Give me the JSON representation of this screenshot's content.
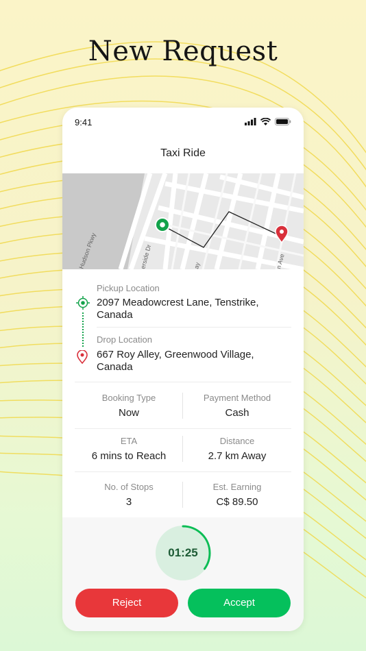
{
  "headline": "New Request",
  "status_bar": {
    "time": "9:41"
  },
  "screen": {
    "title": "Taxi Ride"
  },
  "map": {
    "street_labels": [
      "Hudson Pkwy",
      "erside Dr",
      "ay",
      "n Ave"
    ]
  },
  "pickup": {
    "label": "Pickup Location",
    "address": "2097 Meadowcrest Lane, Tenstrike, Canada"
  },
  "drop": {
    "label": "Drop Location",
    "address": "667 Roy Alley, Greenwood Village, Canada"
  },
  "details": {
    "booking_type": {
      "label": "Booking Type",
      "value": "Now"
    },
    "payment_method": {
      "label": "Payment Method",
      "value": "Cash"
    },
    "eta": {
      "label": "ETA",
      "value": "6 mins to Reach"
    },
    "distance": {
      "label": "Distance",
      "value": "2.7 km Away"
    },
    "stops": {
      "label": "No. of Stops",
      "value": "3"
    },
    "earning": {
      "label": "Est. Earning",
      "value": "C$ 89.50"
    }
  },
  "timer": {
    "value": "01:25",
    "progress": 0.35
  },
  "actions": {
    "reject": "Reject",
    "accept": "Accept"
  },
  "colors": {
    "accept": "#05c05c",
    "reject": "#e8373a",
    "pickup_pin": "#12a24a",
    "drop_pin": "#d9303b"
  },
  "icons": [
    "signal-icon",
    "wifi-icon",
    "battery-icon",
    "pickup-target-icon",
    "drop-pin-icon",
    "map-start-marker-icon",
    "map-end-marker-icon"
  ]
}
